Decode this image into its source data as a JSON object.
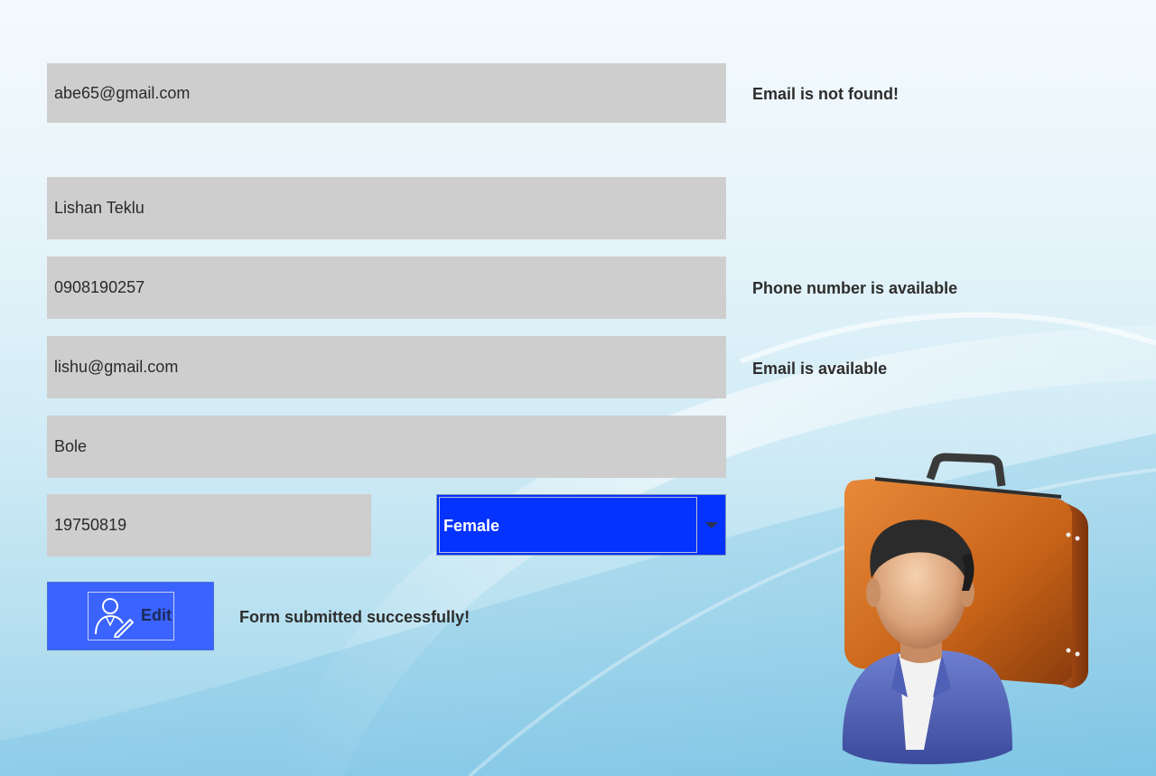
{
  "form": {
    "search_email": "abe65@gmail.com",
    "full_name": "Lishan Teklu",
    "phone": "0908190257",
    "email": "lishu@gmail.com",
    "address": "Bole",
    "birth_date": "19750819",
    "gender": {
      "selected": "Female"
    },
    "edit_label": "Edit"
  },
  "messages": {
    "search_email": "Email is not found!",
    "phone": "Phone number is available",
    "email": "Email is available",
    "submit": "Form submitted successfully!"
  },
  "colors": {
    "field_bg": "#cecece",
    "select_bg": "#0432ff",
    "button_bg": "#3b63ff"
  },
  "icons": {
    "edit": "user-edit-icon",
    "dropdown": "chevron-down-icon",
    "illustration": "businessman-briefcase-icon"
  }
}
